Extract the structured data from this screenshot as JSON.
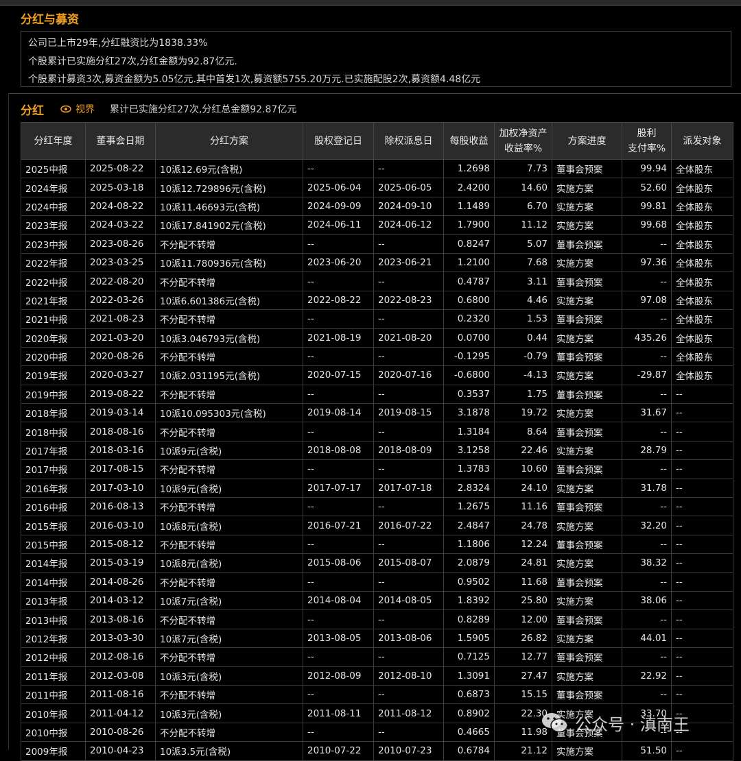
{
  "fundraising": {
    "title": "分红与募资",
    "lines": [
      "公司已上市29年,分红融资比为1838.33%",
      "个股累计已实施分红27次,分红金额为92.87亿元.",
      "个股累计募资3次,募资金额为5.05亿元.其中首发1次,募资额5755.20万元.已实施配股2次,募资额4.48亿元"
    ]
  },
  "dividend": {
    "title": "分红",
    "view_link": "视界",
    "summary": "累计已实施分红27次,分红总金额92.87亿元",
    "headers": [
      "分红年度",
      "董事会日期",
      "分红方案",
      "股权登记日",
      "除权派息日",
      "每股收益",
      "加权净资产\n收益率%",
      "方案进度",
      "股利\n支付率%",
      "派发对象"
    ],
    "rows": [
      [
        "2025中报",
        "2025-08-22",
        "10派12.69元(含税)",
        "--",
        "--",
        "1.2698",
        "7.73",
        "董事会预案",
        "99.94",
        "全体股东"
      ],
      [
        "2024年报",
        "2025-03-18",
        "10派12.729896元(含税)",
        "2025-06-04",
        "2025-06-05",
        "2.4200",
        "14.60",
        "实施方案",
        "52.60",
        "全体股东"
      ],
      [
        "2024中报",
        "2024-08-22",
        "10派11.46693元(含税)",
        "2024-09-09",
        "2024-09-10",
        "1.1489",
        "6.70",
        "实施方案",
        "99.81",
        "全体股东"
      ],
      [
        "2023年报",
        "2024-03-22",
        "10派17.841902元(含税)",
        "2024-06-11",
        "2024-06-12",
        "1.7900",
        "11.12",
        "实施方案",
        "99.68",
        "全体股东"
      ],
      [
        "2023中报",
        "2023-08-26",
        "不分配不转增",
        "--",
        "--",
        "0.8247",
        "5.07",
        "董事会预案",
        "--",
        "全体股东"
      ],
      [
        "2022年报",
        "2023-03-25",
        "10派11.780936元(含税)",
        "2023-06-20",
        "2023-06-21",
        "1.2100",
        "7.68",
        "实施方案",
        "97.36",
        "全体股东"
      ],
      [
        "2022中报",
        "2022-08-20",
        "不分配不转增",
        "--",
        "--",
        "0.4787",
        "3.11",
        "董事会预案",
        "--",
        "全体股东"
      ],
      [
        "2021年报",
        "2022-03-26",
        "10派6.601386元(含税)",
        "2022-08-22",
        "2022-08-23",
        "0.6800",
        "4.46",
        "实施方案",
        "97.08",
        "全体股东"
      ],
      [
        "2021中报",
        "2021-08-23",
        "不分配不转增",
        "--",
        "--",
        "0.2320",
        "1.53",
        "董事会预案",
        "--",
        "全体股东"
      ],
      [
        "2020年报",
        "2021-03-20",
        "10派3.046793元(含税)",
        "2021-08-19",
        "2021-08-20",
        "0.0700",
        "0.44",
        "实施方案",
        "435.26",
        "全体股东"
      ],
      [
        "2020中报",
        "2020-08-26",
        "不分配不转增",
        "--",
        "--",
        "-0.1295",
        "-0.79",
        "董事会预案",
        "--",
        "全体股东"
      ],
      [
        "2019年报",
        "2020-03-27",
        "10派2.031195元(含税)",
        "2020-07-15",
        "2020-07-16",
        "-0.6800",
        "-4.13",
        "实施方案",
        "-29.87",
        "全体股东"
      ],
      [
        "2019中报",
        "2019-08-22",
        "不分配不转增",
        "--",
        "--",
        "0.3537",
        "1.75",
        "董事会预案",
        "--",
        "--"
      ],
      [
        "2018年报",
        "2019-03-14",
        "10派10.095303元(含税)",
        "2019-08-14",
        "2019-08-15",
        "3.1878",
        "19.72",
        "实施方案",
        "31.67",
        "--"
      ],
      [
        "2018中报",
        "2018-08-16",
        "不分配不转增",
        "--",
        "--",
        "1.3184",
        "8.64",
        "董事会预案",
        "--",
        "--"
      ],
      [
        "2017年报",
        "2018-03-16",
        "10派9元(含税)",
        "2018-08-08",
        "2018-08-09",
        "3.1258",
        "22.46",
        "实施方案",
        "28.79",
        "--"
      ],
      [
        "2017中报",
        "2017-08-15",
        "不分配不转增",
        "--",
        "--",
        "1.3783",
        "10.60",
        "董事会预案",
        "--",
        "--"
      ],
      [
        "2016年报",
        "2017-03-10",
        "10派9元(含税)",
        "2017-07-17",
        "2017-07-18",
        "2.8324",
        "24.10",
        "实施方案",
        "31.78",
        "--"
      ],
      [
        "2016中报",
        "2016-08-13",
        "不分配不转增",
        "--",
        "--",
        "1.2675",
        "11.16",
        "董事会预案",
        "--",
        "--"
      ],
      [
        "2015年报",
        "2016-03-10",
        "10派8元(含税)",
        "2016-07-21",
        "2016-07-22",
        "2.4847",
        "24.78",
        "实施方案",
        "32.20",
        "--"
      ],
      [
        "2015中报",
        "2015-08-12",
        "不分配不转增",
        "--",
        "--",
        "1.1806",
        "12.24",
        "董事会预案",
        "--",
        "--"
      ],
      [
        "2014年报",
        "2015-03-19",
        "10派8元(含税)",
        "2015-08-06",
        "2015-08-07",
        "2.0879",
        "24.81",
        "实施方案",
        "38.32",
        "--"
      ],
      [
        "2014中报",
        "2014-08-26",
        "不分配不转增",
        "--",
        "--",
        "0.9502",
        "11.68",
        "董事会预案",
        "--",
        "--"
      ],
      [
        "2013年报",
        "2014-03-12",
        "10派7元(含税)",
        "2014-08-04",
        "2014-08-05",
        "1.8392",
        "25.80",
        "实施方案",
        "38.06",
        "--"
      ],
      [
        "2013中报",
        "2013-08-16",
        "不分配不转增",
        "--",
        "--",
        "0.8289",
        "12.00",
        "董事会预案",
        "--",
        "--"
      ],
      [
        "2012年报",
        "2013-03-30",
        "10派7元(含税)",
        "2013-08-05",
        "2013-08-06",
        "1.5905",
        "26.82",
        "实施方案",
        "44.01",
        "--"
      ],
      [
        "2012中报",
        "2012-08-16",
        "不分配不转增",
        "--",
        "--",
        "0.7125",
        "12.77",
        "董事会预案",
        "--",
        "--"
      ],
      [
        "2011年报",
        "2012-03-08",
        "10派3元(含税)",
        "2012-08-09",
        "2012-08-10",
        "1.3091",
        "27.47",
        "实施方案",
        "22.92",
        "--"
      ],
      [
        "2011中报",
        "2011-08-16",
        "不分配不转增",
        "--",
        "--",
        "0.6873",
        "15.15",
        "董事会预案",
        "--",
        "--"
      ],
      [
        "2010年报",
        "2011-04-12",
        "10派3元(含税)",
        "2011-08-11",
        "2011-08-12",
        "0.8902",
        "22.30",
        "实施方案",
        "33.70",
        "--"
      ],
      [
        "2010中报",
        "2010-08-26",
        "不分配不转增",
        "--",
        "--",
        "0.4665",
        "11.98",
        "董事会预案",
        "--",
        "--"
      ],
      [
        "2009年报",
        "2010-04-23",
        "10派3.5元(含税)",
        "2010-07-22",
        "2010-07-23",
        "0.6784",
        "21.12",
        "实施方案",
        "51.50",
        "--"
      ]
    ]
  },
  "watermark": {
    "text": "公众号 · 滇南王",
    "icon": "wechat-icon"
  },
  "colors": {
    "accent": "#f0a020",
    "background": "#000000",
    "header_bg": "#2b2b2b",
    "border": "#3c3c3c"
  }
}
